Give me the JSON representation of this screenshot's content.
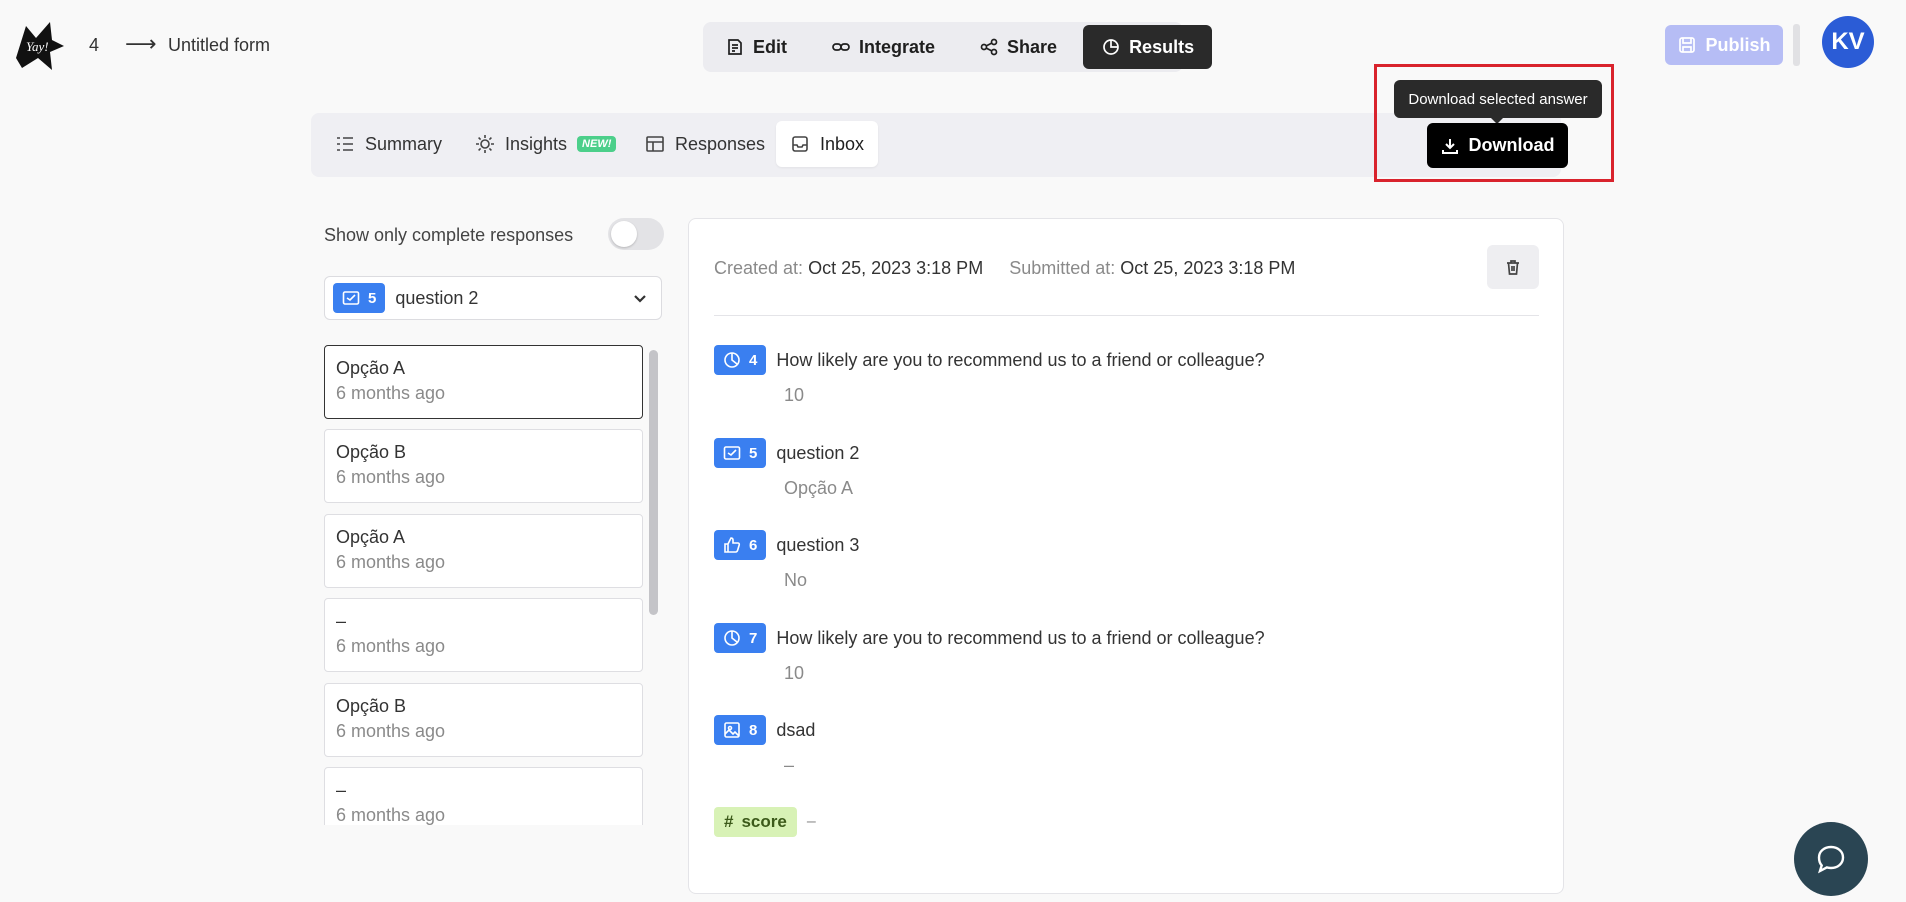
{
  "header": {
    "form_number": "4",
    "arrow": "⟶",
    "form_title": "Untitled form",
    "nav": [
      {
        "label": "Edit",
        "icon": "edit-icon"
      },
      {
        "label": "Integrate",
        "icon": "link-icon"
      },
      {
        "label": "Share",
        "icon": "share-icon"
      },
      {
        "label": "Results",
        "icon": "pie-chart-icon",
        "active": true
      }
    ],
    "publish_label": "Publish",
    "avatar_initials": "KV"
  },
  "subtabs": [
    {
      "label": "Summary",
      "icon": "list-icon"
    },
    {
      "label": "Insights",
      "icon": "sun-icon",
      "badge": "NEW!"
    },
    {
      "label": "Responses",
      "icon": "table-icon"
    },
    {
      "label": "Inbox",
      "icon": "inbox-icon",
      "active": true
    }
  ],
  "download": {
    "tooltip": "Download selected answer",
    "label": "Download"
  },
  "filter": {
    "toggle_label": "Show only complete responses",
    "toggle_on": false,
    "question_number": "5",
    "question_label": "question 2"
  },
  "responses": [
    {
      "title": "Opção A",
      "date": "6 months ago",
      "selected": true
    },
    {
      "title": "Opção B",
      "date": "6 months ago"
    },
    {
      "title": "Opção A",
      "date": "6 months ago"
    },
    {
      "title": "–",
      "date": "6 months ago"
    },
    {
      "title": "Opção B",
      "date": "6 months ago"
    },
    {
      "title": "–",
      "date": "6 months ago"
    }
  ],
  "detail": {
    "created_label": "Created at:",
    "created_value": "Oct 25, 2023 3:18 PM",
    "submitted_label": "Submitted at:",
    "submitted_value": "Oct 25, 2023 3:18 PM",
    "answers": [
      {
        "num": "4",
        "icon": "gauge-icon",
        "question": "How likely are you to recommend us to a friend or colleague?",
        "answer": "10"
      },
      {
        "num": "5",
        "icon": "checkbox-icon",
        "question": "question 2",
        "answer": "Opção A"
      },
      {
        "num": "6",
        "icon": "thumbs-up-icon",
        "question": "question 3",
        "answer": "No"
      },
      {
        "num": "7",
        "icon": "gauge-icon",
        "question": "How likely are you to recommend us to a friend or colleague?",
        "answer": "10"
      },
      {
        "num": "8",
        "icon": "image-icon",
        "question": "dsad",
        "answer": "–"
      }
    ],
    "score_label": "score",
    "score_value": "–"
  },
  "colors": {
    "accent_blue": "#3a7ff0",
    "highlight_red": "#d9232d",
    "avatar_blue": "#2b5cd6",
    "chat_bg": "#2a4553"
  }
}
